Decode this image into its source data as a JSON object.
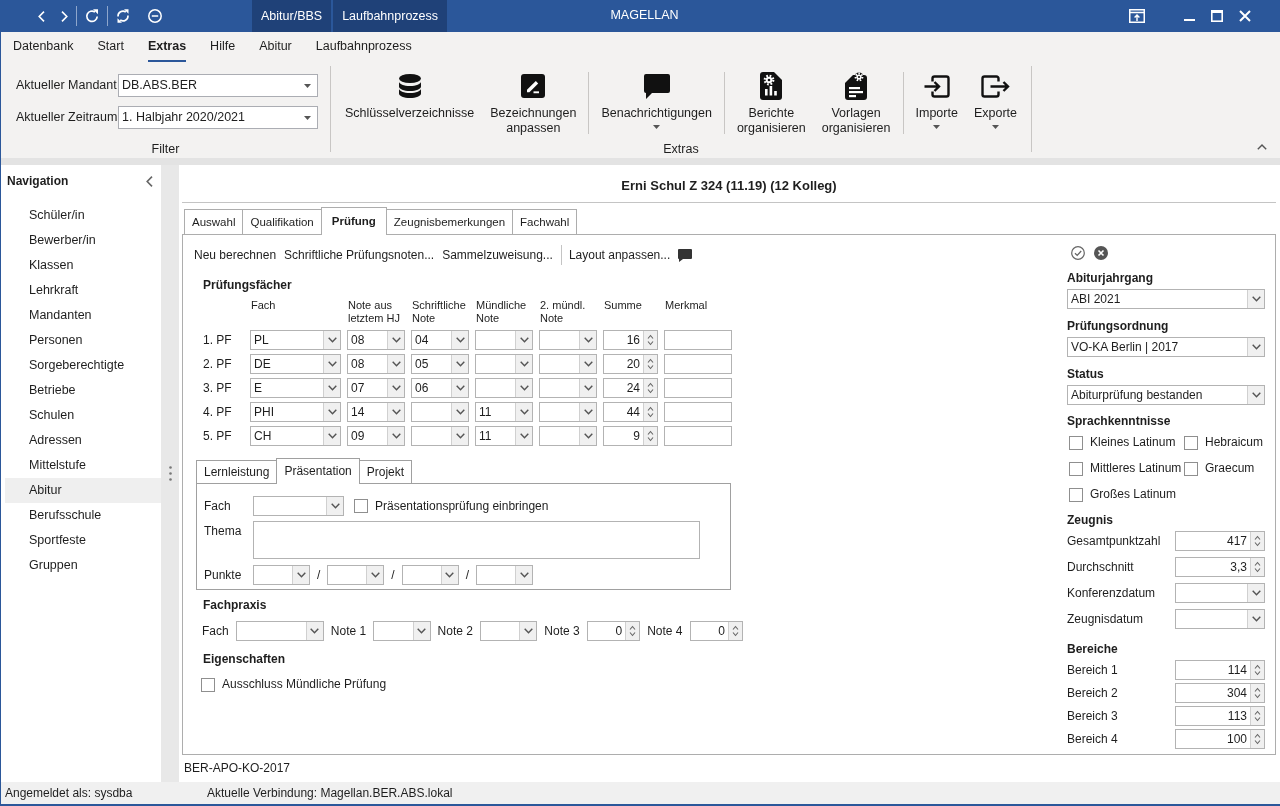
{
  "title_bar": {
    "tabs": [
      "Abitur/BBS",
      "Laufbahnprozess"
    ],
    "title": "MAGELLAN"
  },
  "ribbon": {
    "tabs": [
      {
        "label": "Datenbank",
        "selected": false
      },
      {
        "label": "Start",
        "selected": false
      },
      {
        "label": "Extras",
        "selected": true
      },
      {
        "label": "Hilfe",
        "selected": false
      },
      {
        "label": "Abitur",
        "selected": false
      },
      {
        "label": "Laufbahnprozess",
        "selected": false
      }
    ],
    "filter": {
      "fields": [
        {
          "label": "Aktueller Mandant",
          "value": "DB.ABS.BER"
        },
        {
          "label": "Aktueller Zeitraum",
          "value": "1. Halbjahr 2020/2021"
        }
      ],
      "label": "Filter"
    },
    "extras": {
      "groups": [
        [
          {
            "label": "Schlüsselverzeichnisse",
            "dropdown": false
          },
          {
            "label": "Bezeichnungen anpassen",
            "dropdown": false
          }
        ],
        [
          {
            "label": "Benachrichtigungen",
            "dropdown": true
          }
        ],
        [
          {
            "label": "Berichte organisieren",
            "dropdown": false
          },
          {
            "label": "Vorlagen organisieren",
            "dropdown": false
          }
        ],
        [
          {
            "label": "Importe",
            "dropdown": true
          },
          {
            "label": "Exporte",
            "dropdown": true
          }
        ]
      ],
      "label": "Extras"
    }
  },
  "navigation": {
    "title": "Navigation",
    "items": [
      {
        "label": "Schüler/in",
        "selected": false
      },
      {
        "label": "Bewerber/in",
        "selected": false
      },
      {
        "label": "Klassen",
        "selected": false
      },
      {
        "label": "Lehrkraft",
        "selected": false
      },
      {
        "label": "Mandanten",
        "selected": false
      },
      {
        "label": "Personen",
        "selected": false
      },
      {
        "label": "Sorgeberechtigte",
        "selected": false
      },
      {
        "label": "Betriebe",
        "selected": false
      },
      {
        "label": "Schulen",
        "selected": false
      },
      {
        "label": "Adressen",
        "selected": false
      },
      {
        "label": "Mittelstufe",
        "selected": false
      },
      {
        "label": "Abitur",
        "selected": true
      },
      {
        "label": "Berufsschule",
        "selected": false
      },
      {
        "label": "Sportfeste",
        "selected": false
      },
      {
        "label": "Gruppen",
        "selected": false
      }
    ]
  },
  "record": {
    "title": "Erni Schul Z 324 (11.19) (12 Kolleg)",
    "tabs": [
      {
        "label": "Auswahl",
        "selected": false
      },
      {
        "label": "Qualifikation",
        "selected": false
      },
      {
        "label": "Prüfung",
        "selected": true
      },
      {
        "label": "Zeugnisbemerkungen",
        "selected": false
      },
      {
        "label": "Fachwahl",
        "selected": false
      }
    ],
    "toolbar": [
      [
        "Neu berechnen",
        "Schriftliche Prüfungsnoten...",
        "Sammelzuweisung..."
      ],
      [
        "Layout anpassen..."
      ]
    ],
    "exam_subjects": {
      "title": "Prüfungsfächer",
      "columns": [
        {
          "label": "Fach",
          "kind": "dropdown"
        },
        {
          "label": "Note aus letztem HJ",
          "kind": "dropdown"
        },
        {
          "label": "Schriftliche Note",
          "kind": "dropdown"
        },
        {
          "label": "Mündliche Note",
          "kind": "dropdown"
        },
        {
          "label": "2. mündl. Note",
          "kind": "dropdown"
        },
        {
          "label": "Summe",
          "kind": "spin"
        },
        {
          "label": "Merkmal",
          "kind": "text"
        }
      ],
      "rows": [
        {
          "label": "1. PF",
          "subject": "PL",
          "last_term": "08",
          "written": "04",
          "sum": "16"
        },
        {
          "label": "2. PF",
          "subject": "DE",
          "last_term": "08",
          "written": "05",
          "sum": "20"
        },
        {
          "label": "3. PF",
          "subject": "E",
          "last_term": "07",
          "written": "06",
          "sum": "24"
        },
        {
          "label": "4. PF",
          "subject": "PHI",
          "last_term": "14",
          "oral": "11",
          "sum": "44"
        },
        {
          "label": "5. PF",
          "subject": "CH",
          "last_term": "09",
          "oral": "11",
          "sum": "9"
        }
      ]
    },
    "presentation": {
      "tabs": [
        {
          "label": "Lernleistung",
          "selected": false
        },
        {
          "label": "Präsentation",
          "selected": true
        },
        {
          "label": "Projekt",
          "selected": false
        }
      ],
      "subject": {
        "label": "Fach"
      },
      "include": {
        "label": "Präsentationsprüfung einbringen",
        "checked": false
      },
      "topic": {
        "label": "Thema"
      },
      "points": {
        "label": "Punkte",
        "separators": [
          "/",
          "/",
          "/"
        ]
      }
    },
    "practice": {
      "title": "Fachpraxis",
      "fields": [
        {
          "label": "Fach",
          "kind": "dropdown"
        },
        {
          "label": "Note 1",
          "kind": "dropdown"
        },
        {
          "label": "Note 2",
          "kind": "dropdown"
        },
        {
          "label": "Note 3",
          "kind": "spin",
          "value": "0"
        },
        {
          "label": "Note 4",
          "kind": "spin",
          "value": "0"
        }
      ]
    },
    "properties": {
      "title": "Eigenschaften",
      "options": [
        {
          "label": "Ausschluss Mündliche Prüfung",
          "checked": false
        }
      ]
    },
    "side_panel": {
      "selects": [
        {
          "label": "Abiturjahrgang",
          "value": "ABI 2021"
        },
        {
          "label": "Prüfungsordnung",
          "value": "VO-KA Berlin | 2017"
        },
        {
          "label": "Status",
          "value": "Abiturprüfung bestanden"
        }
      ],
      "languages": {
        "title": "Sprachkenntnisse",
        "options": [
          {
            "label": "Kleines Latinum",
            "checked": false
          },
          {
            "label": "Hebraicum",
            "checked": false
          },
          {
            "label": "Mittleres Latinum",
            "checked": false
          },
          {
            "label": "Graecum",
            "checked": false
          },
          {
            "label": "Großes Latinum",
            "checked": false
          }
        ]
      },
      "certificate": {
        "title": "Zeugnis",
        "fields": [
          {
            "label": "Gesamtpunktzahl",
            "kind": "spin",
            "value": "417"
          },
          {
            "label": "Durchschnitt",
            "kind": "spin",
            "value": "3,3"
          },
          {
            "label": "Konferenzdatum",
            "kind": "dropdown"
          },
          {
            "label": "Zeugnisdatum",
            "kind": "dropdown"
          }
        ]
      },
      "areas": {
        "title": "Bereiche",
        "fields": [
          {
            "label": "Bereich 1",
            "kind": "spin",
            "value": "114"
          },
          {
            "label": "Bereich 2",
            "kind": "spin",
            "value": "304"
          },
          {
            "label": "Bereich 3",
            "kind": "spin",
            "value": "113"
          },
          {
            "label": "Bereich 4",
            "kind": "spin",
            "value": "100"
          }
        ]
      }
    },
    "footer": "BER-APO-KO-2017"
  },
  "status_bar": [
    "Angemeldet als: sysdba",
    "Aktuelle Verbindung: Magellan.BER.ABS.lokal"
  ]
}
